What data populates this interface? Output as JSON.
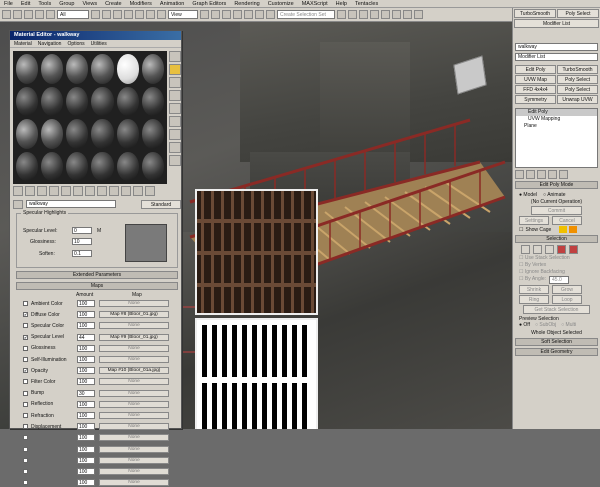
{
  "menubar": [
    "File",
    "Edit",
    "Tools",
    "Group",
    "Views",
    "Create",
    "Modifiers",
    "Animation",
    "Graph Editors",
    "Rendering",
    "Customize",
    "MAXScript",
    "Help",
    "Tentacles"
  ],
  "toolbar": {
    "selection_filter": "All",
    "view": "View",
    "named_selection_placeholder": "Create Selection Set"
  },
  "side_panel": {
    "top_buttons": [
      "TurboSmooth",
      "Poly Select",
      "Modifier List"
    ],
    "object_name": "walkway",
    "modifier_list_label": "Modifier List",
    "mod_buttons": [
      "Edit Poly",
      "TurboSmooth",
      "UVW Map",
      "Poly Select",
      "FFD 4x4x4",
      "Poly Select",
      "Symmetry",
      "Unwrap UVW"
    ],
    "stack": [
      "Edit Poly",
      "UVW Mapping",
      "Plane"
    ],
    "rollouts": {
      "edit_poly_mode": "Edit Poly Mode",
      "model": "Model",
      "animate": "Animate",
      "no_current_op": "(No Current Operation)",
      "commit": "Commit",
      "settings": "Settings",
      "cancel": "Cancel",
      "show_cage": "Show Cage",
      "selection": "Selection",
      "use_stack_selection": "Use Stack Selection",
      "by_vertex": "By Vertex",
      "ignore_backfacing": "Ignore Backfacing",
      "by_angle": "By Angle:",
      "by_angle_value": "45.0",
      "shrink": "Shrink",
      "grow": "Grow",
      "ring": "Ring",
      "loop": "Loop",
      "get_stack_selection": "Get Stack Selection",
      "preview_selection": "Preview Selection",
      "off": "Off",
      "subobj": "SubObj",
      "multi": "Multi",
      "whole_object_selected": "Whole Object Selected",
      "soft_selection": "Soft Selection",
      "edit_geometry": "Edit Geometry"
    }
  },
  "material_editor": {
    "title": "Material Editor - walkway",
    "menu": [
      "Material",
      "Navigation",
      "Options",
      "Utilities"
    ],
    "material_name": "walkway",
    "material_type": "Standard",
    "specular_highlights": {
      "header": "Specular Highlights",
      "specular_level_label": "Specular Level:",
      "specular_level": "0",
      "glossiness_label": "Glossiness:",
      "glossiness": "10",
      "soften_label": "Soften:",
      "soften": "0.1",
      "m_label": "M"
    },
    "extended_parameters": "Extended Parameters",
    "maps_header": "Maps",
    "col_amount": "Amount",
    "col_map": "Map",
    "maps": [
      {
        "name": "Ambient Color",
        "checked": false,
        "amount": "100",
        "map": "None"
      },
      {
        "name": "Diffuse Color",
        "checked": true,
        "amount": "100",
        "map": "Map #8 (Bloor_01.jpg)"
      },
      {
        "name": "Specular Color",
        "checked": false,
        "amount": "100",
        "map": "None"
      },
      {
        "name": "Specular Level",
        "checked": true,
        "amount": "44",
        "map": "Map #9 (Bloor_01.jpg)"
      },
      {
        "name": "Glossiness",
        "checked": false,
        "amount": "100",
        "map": "None"
      },
      {
        "name": "Self-Illumination",
        "checked": false,
        "amount": "100",
        "map": "None"
      },
      {
        "name": "Opacity",
        "checked": true,
        "amount": "100",
        "map": "Map #10 (Bloor_01a.jpg)"
      },
      {
        "name": "Filter Color",
        "checked": false,
        "amount": "100",
        "map": "None"
      },
      {
        "name": "Bump",
        "checked": false,
        "amount": "30",
        "map": "None"
      },
      {
        "name": "Reflection",
        "checked": false,
        "amount": "100",
        "map": "None"
      },
      {
        "name": "Refraction",
        "checked": false,
        "amount": "100",
        "map": "None"
      },
      {
        "name": "Displacement",
        "checked": false,
        "amount": "100",
        "map": "None"
      },
      {
        "name": "",
        "checked": false,
        "amount": "100",
        "map": "None"
      },
      {
        "name": "",
        "checked": false,
        "amount": "100",
        "map": "None"
      },
      {
        "name": "",
        "checked": false,
        "amount": "100",
        "map": "None"
      },
      {
        "name": "",
        "checked": false,
        "amount": "100",
        "map": "None"
      },
      {
        "name": "",
        "checked": false,
        "amount": "100",
        "map": "None"
      }
    ]
  },
  "colors": {
    "railing": "#8a2a25",
    "grating": "#c9a46a",
    "accent_yellow": "#f0c000",
    "accent_orange": "#f09000"
  }
}
